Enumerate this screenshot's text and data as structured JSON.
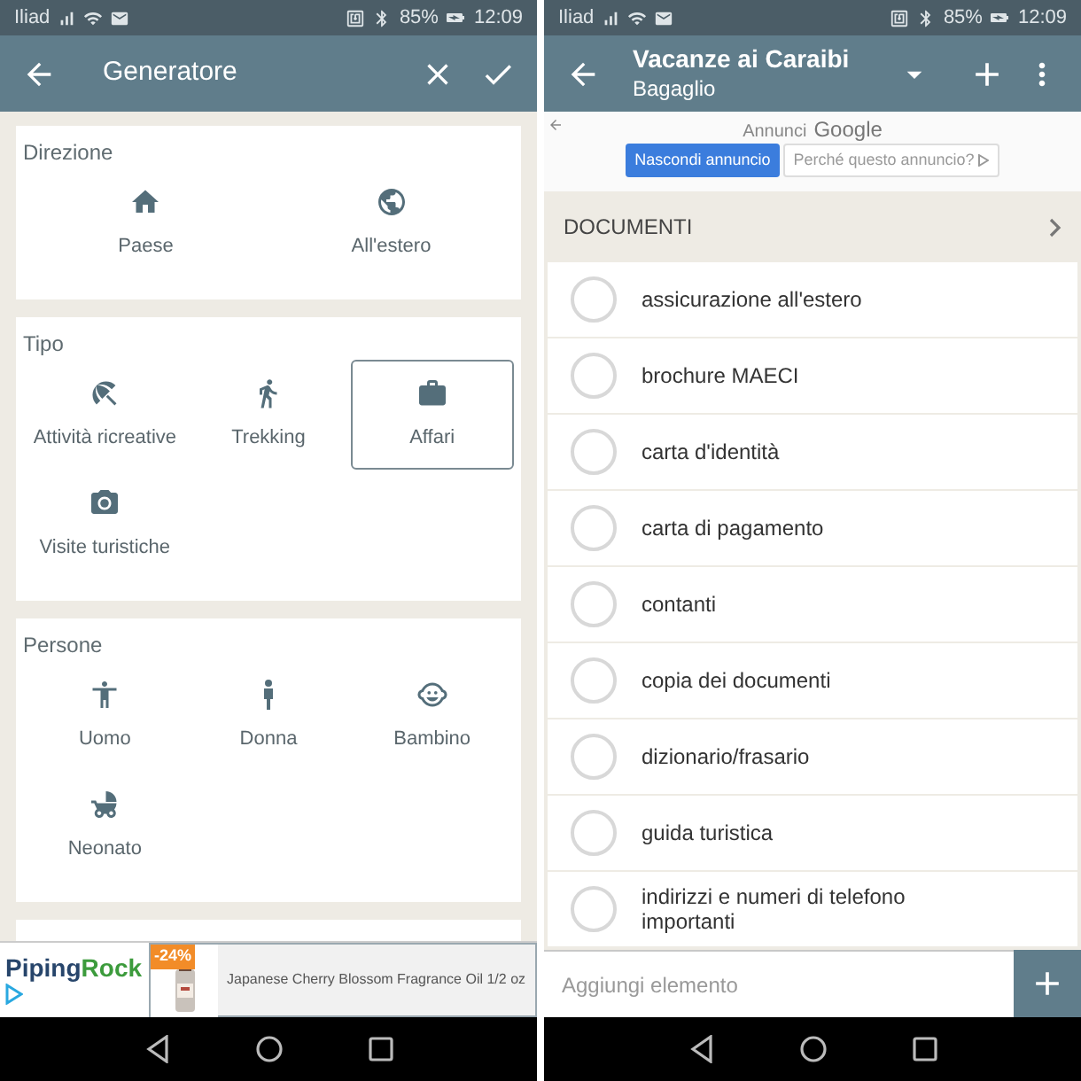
{
  "left": {
    "status_bar": {
      "carrier": "Iliad",
      "battery": "85%",
      "time": "12:09"
    },
    "app_bar": {
      "title": "Generatore"
    },
    "sections": [
      {
        "title": "Direzione",
        "options": [
          {
            "label": "Paese",
            "selected": false
          },
          {
            "label": "All'estero",
            "selected": false
          }
        ]
      },
      {
        "title": "Tipo",
        "options": [
          {
            "label": "Attività ricreative",
            "selected": false
          },
          {
            "label": "Trekking",
            "selected": false
          },
          {
            "label": "Affari",
            "selected": true
          },
          {
            "label": "Visite turistiche",
            "selected": false
          }
        ]
      },
      {
        "title": "Persone",
        "options": [
          {
            "label": "Uomo",
            "selected": false
          },
          {
            "label": "Donna",
            "selected": false
          },
          {
            "label": "Bambino",
            "selected": false
          },
          {
            "label": "Neonato",
            "selected": false
          }
        ]
      }
    ],
    "ad": {
      "brand": [
        "Piping",
        "Rock"
      ],
      "discount": "-24%",
      "product": "Japanese Cherry Blossom Fragrance Oil 1/2 oz"
    }
  },
  "right": {
    "status_bar": {
      "carrier": "Iliad",
      "battery": "85%",
      "time": "12:09"
    },
    "app_bar": {
      "title": "Vacanze ai Caraibi",
      "subtitle": "Bagaglio"
    },
    "ad": {
      "label": "Annunci",
      "brand": "Google",
      "buttons": [
        "Nascondi annuncio",
        "Perché questo annuncio?"
      ]
    },
    "category": "DOCUMENTI",
    "items": [
      {
        "label": "assicurazione all'estero",
        "checked": false
      },
      {
        "label": "brochure MAECI",
        "checked": false
      },
      {
        "label": "carta d'identità",
        "checked": false
      },
      {
        "label": "carta di pagamento",
        "checked": false
      },
      {
        "label": "contanti",
        "checked": false
      },
      {
        "label": "copia dei documenti",
        "checked": false
      },
      {
        "label": "dizionario/frasario",
        "checked": false
      },
      {
        "label": "guida turistica",
        "checked": false
      },
      {
        "label": "indirizzi e numeri di telefono importanti",
        "checked": false
      }
    ],
    "add_field": {
      "placeholder": "Aggiungi elemento"
    }
  }
}
